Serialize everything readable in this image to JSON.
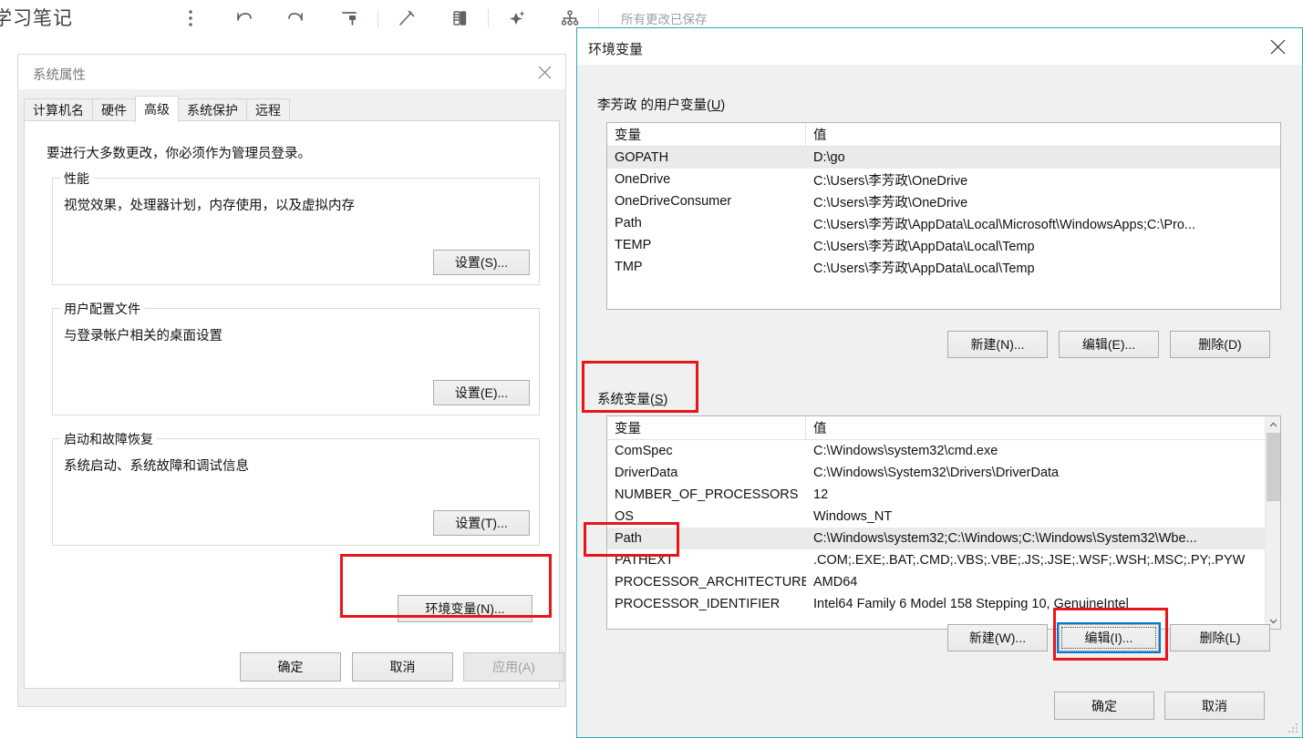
{
  "note_app": {
    "title": "学习笔记",
    "status": "所有更改已保存",
    "toolbar_icons": [
      "more-vertical-icon",
      "undo-icon",
      "redo-icon",
      "format-paint-icon",
      "pen-icon",
      "highlighter-icon",
      "magic-wand-icon",
      "mindmap-icon"
    ]
  },
  "system_properties": {
    "title": "系统属性",
    "tabs": [
      {
        "label": "计算机名",
        "active": false
      },
      {
        "label": "硬件",
        "active": false
      },
      {
        "label": "高级",
        "active": true
      },
      {
        "label": "系统保护",
        "active": false
      },
      {
        "label": "远程",
        "active": false
      }
    ],
    "hint": "要进行大多数更改，你必须作为管理员登录。",
    "groups": [
      {
        "label": "性能",
        "desc": "视觉效果，处理器计划，内存使用，以及虚拟内存",
        "button": "设置(S)..."
      },
      {
        "label": "用户配置文件",
        "desc": "与登录帐户相关的桌面设置",
        "button": "设置(E)..."
      },
      {
        "label": "启动和故障恢复",
        "desc": "系统启动、系统故障和调试信息",
        "button": "设置(T)..."
      }
    ],
    "env_button": "环境变量(N)...",
    "footer": {
      "ok": "确定",
      "cancel": "取消",
      "apply": "应用(A)",
      "apply_disabled": true
    }
  },
  "environment_variables": {
    "title": "环境变量",
    "close_icon": "close-icon",
    "user_section": {
      "label_prefix": "李芳政 的用户变量(",
      "label_accel": "U",
      "label_suffix": ")",
      "columns": [
        "变量",
        "值"
      ],
      "rows": [
        {
          "name": "GOPATH",
          "value": "D:\\go",
          "selected": true
        },
        {
          "name": "OneDrive",
          "value": "C:\\Users\\李芳政\\OneDrive",
          "selected": false
        },
        {
          "name": "OneDriveConsumer",
          "value": "C:\\Users\\李芳政\\OneDrive",
          "selected": false
        },
        {
          "name": "Path",
          "value": "C:\\Users\\李芳政\\AppData\\Local\\Microsoft\\WindowsApps;C:\\Pro...",
          "selected": false
        },
        {
          "name": "TEMP",
          "value": "C:\\Users\\李芳政\\AppData\\Local\\Temp",
          "selected": false
        },
        {
          "name": "TMP",
          "value": "C:\\Users\\李芳政\\AppData\\Local\\Temp",
          "selected": false
        }
      ],
      "buttons": {
        "new": "新建(N)...",
        "edit": "编辑(E)...",
        "delete": "删除(D)"
      }
    },
    "system_section": {
      "label_prefix": "系统变量(",
      "label_accel": "S",
      "label_suffix": ")",
      "columns": [
        "变量",
        "值"
      ],
      "rows": [
        {
          "name": "ComSpec",
          "value": "C:\\Windows\\system32\\cmd.exe",
          "selected": false
        },
        {
          "name": "DriverData",
          "value": "C:\\Windows\\System32\\Drivers\\DriverData",
          "selected": false
        },
        {
          "name": "NUMBER_OF_PROCESSORS",
          "value": "12",
          "selected": false
        },
        {
          "name": "OS",
          "value": "Windows_NT",
          "selected": false
        },
        {
          "name": "Path",
          "value": "C:\\Windows\\system32;C:\\Windows;C:\\Windows\\System32\\Wbe...",
          "selected": true
        },
        {
          "name": "PATHEXT",
          "value": ".COM;.EXE;.BAT;.CMD;.VBS;.VBE;.JS;.JSE;.WSF;.WSH;.MSC;.PY;.PYW",
          "selected": false
        },
        {
          "name": "PROCESSOR_ARCHITECTURE",
          "value": "AMD64",
          "selected": false
        },
        {
          "name": "PROCESSOR_IDENTIFIER",
          "value": "Intel64 Family 6 Model 158 Stepping 10, GenuineIntel",
          "selected": false
        }
      ],
      "buttons": {
        "new": "新建(W)...",
        "edit": "编辑(I)...",
        "delete": "删除(L)"
      },
      "edit_focused": true
    },
    "footer": {
      "ok": "确定",
      "cancel": "取消"
    }
  },
  "annotations": {
    "color": "#e8161a",
    "boxes": [
      "env-button-highlight",
      "system-variables-label-highlight",
      "system-path-row-highlight",
      "system-edit-button-highlight"
    ]
  }
}
